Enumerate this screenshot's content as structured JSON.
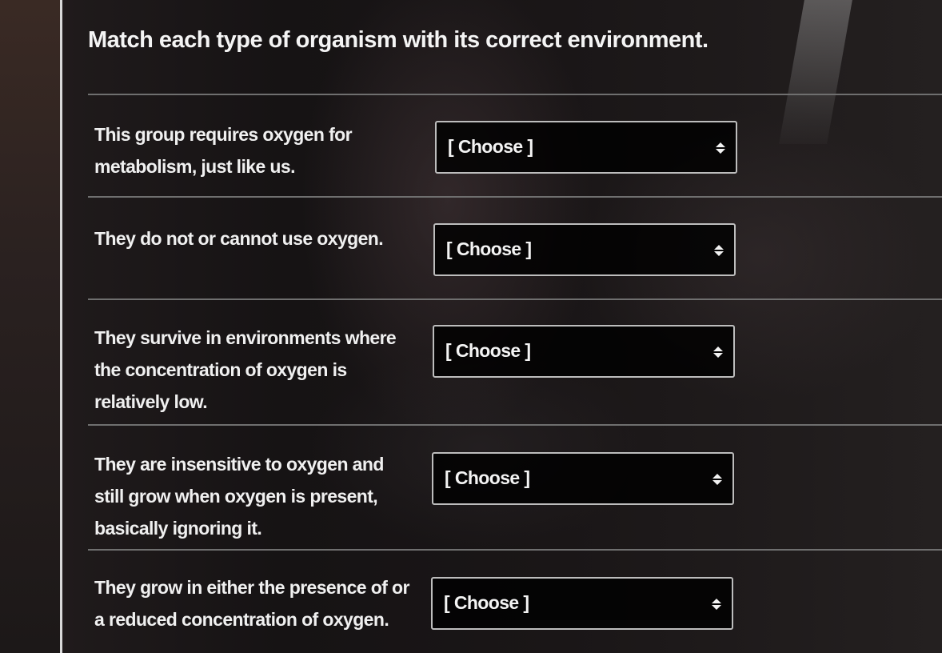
{
  "question": {
    "title": "Match each type of organism with its correct environment."
  },
  "rows": [
    {
      "prompt_lines": [
        "This group requires oxygen for",
        "metabolism, just like us."
      ],
      "select_value": "[ Choose ]"
    },
    {
      "prompt_lines": [
        "They do not or cannot use oxygen."
      ],
      "select_value": "[ Choose ]"
    },
    {
      "prompt_lines": [
        "They survive in environments where",
        "the concentration of oxygen is",
        "relatively low."
      ],
      "select_value": "[ Choose ]"
    },
    {
      "prompt_lines": [
        "They are insensitive to oxygen and",
        "still grow when oxygen is present,",
        "basically ignoring it."
      ],
      "select_value": "[ Choose ]"
    },
    {
      "prompt_lines": [
        "They grow in either the presence of or",
        "a reduced concentration of oxygen."
      ],
      "select_value": "[ Choose ]"
    }
  ],
  "icons": {
    "select_arrow": "up-down-chevron-icon"
  }
}
